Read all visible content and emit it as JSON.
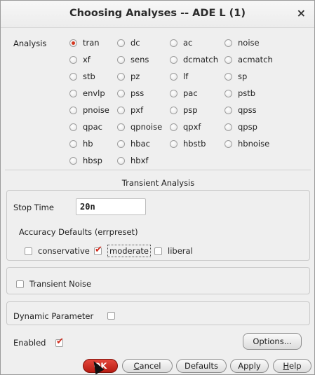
{
  "window": {
    "title": "Choosing Analyses -- ADE L (1)",
    "close_glyph": "×"
  },
  "analysis": {
    "label": "Analysis",
    "options": [
      [
        "tran",
        "dc",
        "ac",
        "noise"
      ],
      [
        "xf",
        "sens",
        "dcmatch",
        "acmatch"
      ],
      [
        "stb",
        "pz",
        "lf",
        "sp"
      ],
      [
        "envlp",
        "pss",
        "pac",
        "pstb"
      ],
      [
        "pnoise",
        "pxf",
        "psp",
        "qpss"
      ],
      [
        "qpac",
        "qpnoise",
        "qpxf",
        "qpsp"
      ],
      [
        "hb",
        "hbac",
        "hbstb",
        "hbnoise"
      ],
      [
        "hbsp",
        "hbxf"
      ]
    ],
    "selected": "tran"
  },
  "transient": {
    "title": "Transient Analysis",
    "stop_time_label": "Stop Time",
    "stop_time_value": "20n",
    "accuracy_label": "Accuracy Defaults (errpreset)",
    "accuracy_options": [
      "conservative",
      "moderate",
      "liberal"
    ],
    "accuracy_selected": "moderate",
    "transient_noise_label": "Transient Noise",
    "dynamic_parameter_label": "Dynamic Parameter"
  },
  "enabled_label": "Enabled",
  "options_button": "Options...",
  "buttons": {
    "ok": "OK",
    "cancel_pre": "",
    "cancel_u": "C",
    "cancel_post": "ancel",
    "defaults": "Defaults",
    "apply": "Apply",
    "help_pre": "",
    "help_u": "H",
    "help_post": "elp"
  },
  "accent_color": "#d4371f"
}
